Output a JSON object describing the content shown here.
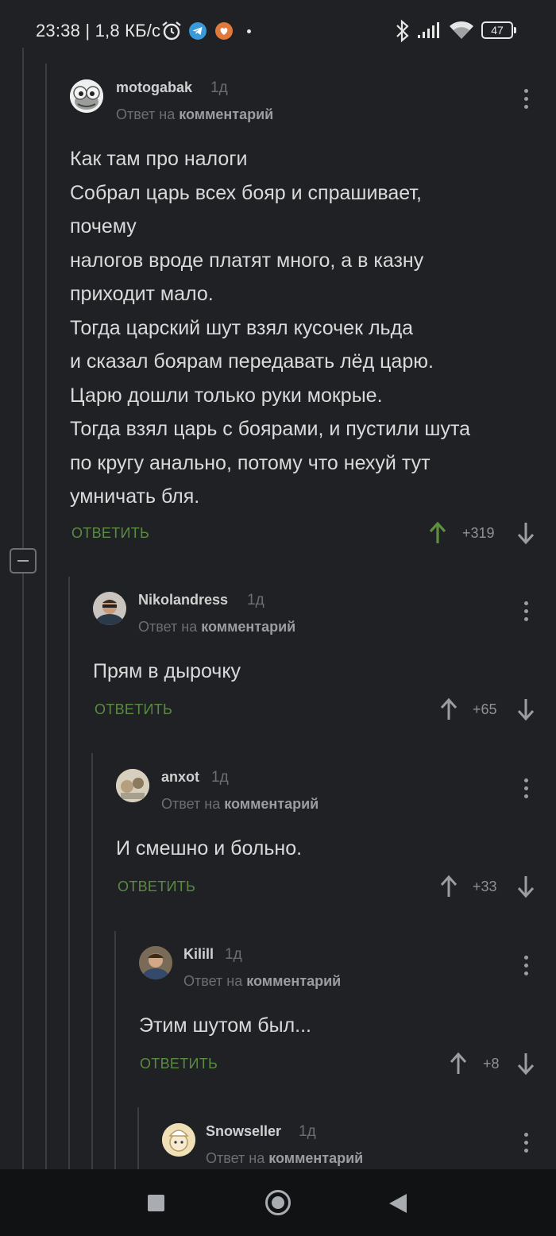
{
  "status_bar": {
    "time_speed": "23:38 | 1,8 КБ/с",
    "battery": "47",
    "icons": [
      "alarm-icon",
      "telegram-icon",
      "app-icon",
      "dot-icon",
      "bluetooth-icon",
      "signal-icon",
      "wifi-icon",
      "battery-icon"
    ]
  },
  "comments": [
    {
      "username": "motogabak",
      "time": "1д",
      "reply_prefix": "Ответ на",
      "reply_link": "комментарий",
      "text": "Как там про налоги\nСобрал царь всех бояр и спрашивает,\nпочему\nналогов вроде платят много, а в казну\nприходит мало.\nТогда царский шут взял кусочек льда\nи сказал боярам передавать лёд царю.\nЦарю дошли только руки мокрые.\nТогда взял царь с боярами, и пустили шута\nпо кругу анально, потому что нехуй тут\nумничать бля.",
      "reply_label": "ОТВЕТИТЬ",
      "score": "+319",
      "voted_up": true
    },
    {
      "username": "Nikolandress",
      "time": "1д",
      "reply_prefix": "Ответ на",
      "reply_link": "комментарий",
      "text": "Прям в дырочку",
      "reply_label": "ОТВЕТИТЬ",
      "score": "+65",
      "voted_up": false
    },
    {
      "username": "anxot",
      "time": "1д",
      "reply_prefix": "Ответ на",
      "reply_link": "комментарий",
      "text": "И смешно и больно.",
      "reply_label": "ОТВЕТИТЬ",
      "score": "+33",
      "voted_up": false
    },
    {
      "username": "Kilill",
      "time": "1д",
      "reply_prefix": "Ответ на",
      "reply_link": "комментарий",
      "text": "Этим шутом был...",
      "reply_label": "ОТВЕТИТЬ",
      "score": "+8",
      "voted_up": false
    },
    {
      "username": "Snowseller",
      "time": "1д",
      "reply_prefix": "Ответ на",
      "reply_link": "комментарий"
    }
  ],
  "colors": {
    "background": "#1f2124",
    "reply_green": "#5b8a42",
    "upvote_active": "#5d8f3e",
    "muted": "#6b6e73"
  },
  "nav_bar": {
    "icons": [
      "square-icon",
      "circle-icon",
      "back-triangle-icon"
    ]
  }
}
